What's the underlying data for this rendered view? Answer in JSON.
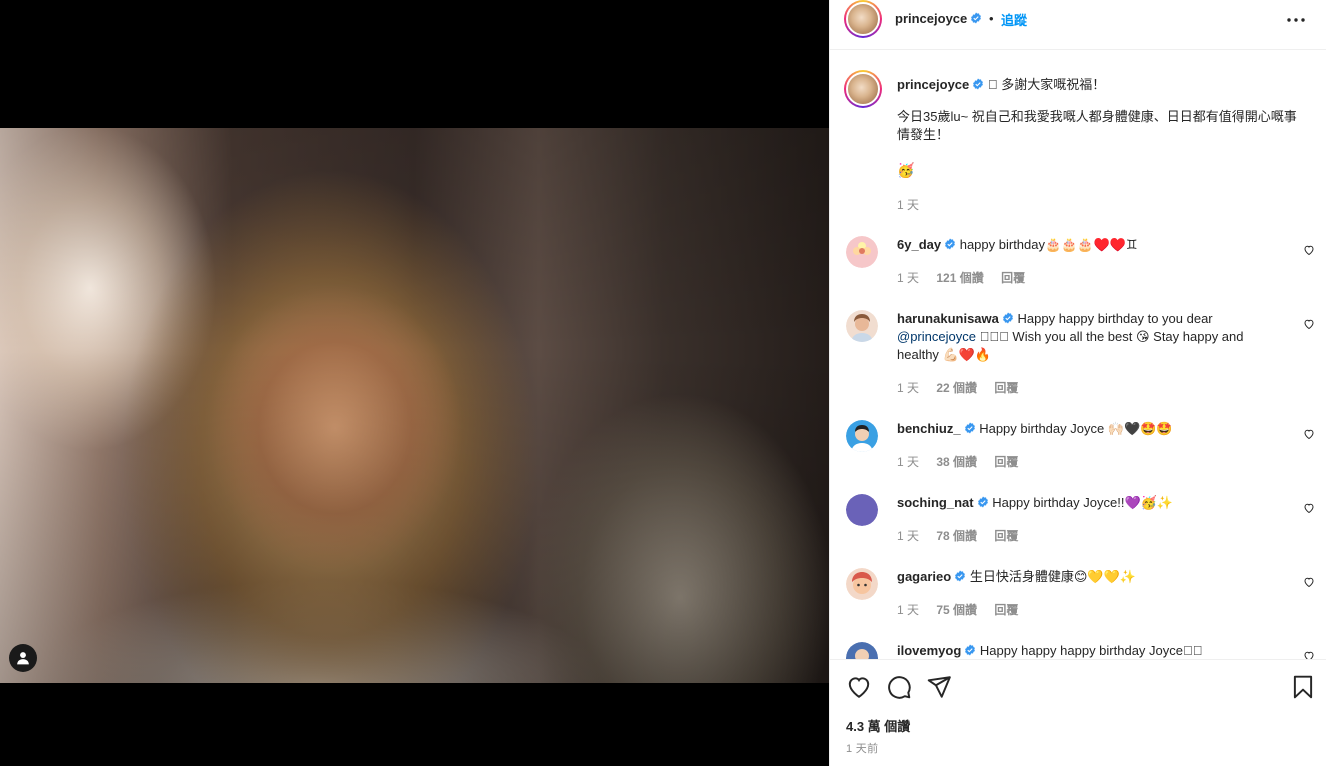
{
  "header": {
    "username": "princejoyce",
    "dot": "•",
    "follow_label": "追蹤"
  },
  "caption": {
    "username": "princejoyce",
    "headline": "􀀀 多謝大家嘅祝福！",
    "body": "今日35歲lu~ 祝自己和我愛我嘅人都身體健康、日日都有值得開心嘅事情發生！",
    "emoji": "🥳",
    "time": "1 天"
  },
  "comments": [
    {
      "username": "6y_day",
      "text": "happy birthday🎂🎂🎂♥️♥️♊",
      "time": "1 天",
      "likes": "121 個讚",
      "reply": "回覆",
      "avatar_color": "#f6c7c9"
    },
    {
      "username": "harunakunisawa",
      "text_pre": "Happy happy birthday to you dear",
      "mention": "@princejoyce",
      "text_post": " 􀀀􀀀􀀀 Wish you all the best 😘 Stay happy and healthy 💪🏻❤️🔥",
      "time": "1 天",
      "likes": "22 個讚",
      "reply": "回覆",
      "avatar_color": "#e9c8b5"
    },
    {
      "username": "benchiuz_",
      "text": "Happy birthday Joyce 🙌🏻🖤🤩🤩",
      "time": "1 天",
      "likes": "38 個讚",
      "reply": "回覆",
      "avatar_color": "#3aa0e3"
    },
    {
      "username": "soching_nat",
      "text": "Happy birthday Joyce!!💜🥳✨",
      "time": "1 天",
      "likes": "78 個讚",
      "reply": "回覆",
      "avatar_color": "#6a62b8"
    },
    {
      "username": "gagarieo",
      "text": "生日快活身體健康😊💛💛✨",
      "time": "1 天",
      "likes": "75 個讚",
      "reply": "回覆",
      "avatar_color": "#d9584a"
    },
    {
      "username": "ilovemyog",
      "text": "Happy happy happy birthday Joyce􀀀􀀀",
      "avatar_color": "#4a6fb0"
    }
  ],
  "actions": {
    "likes_count": "4.3 萬 個讚",
    "post_time": "1 天前"
  },
  "colors": {
    "accent": "#0095f6",
    "verified": "#3897f0",
    "secondary_text": "#8e8e8e"
  }
}
